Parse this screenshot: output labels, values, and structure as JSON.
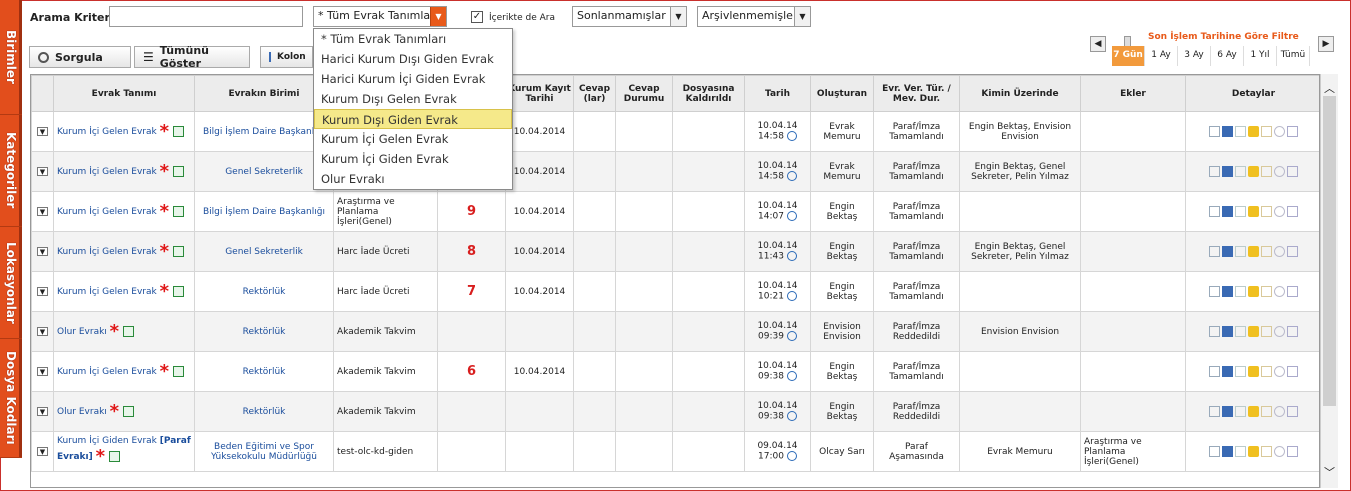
{
  "sidebar": {
    "tabs": [
      "Birimler",
      "Kategoriler",
      "Lokasyonlar",
      "Dosya Kodları"
    ]
  },
  "search": {
    "label": "Arama Kriteri",
    "value": "",
    "placeholder": ""
  },
  "type_select": {
    "selected": "* Tüm Evrak Tanımları"
  },
  "search_in": {
    "label": "İçerikte de Ara",
    "checked": true
  },
  "status_select": {
    "selected": "Sonlanmamışlar"
  },
  "archive_select": {
    "selected": "Arşivlenmemişler"
  },
  "buttons": {
    "query": "Sorgula",
    "show_all": "Tümünü Göster",
    "columns": "Kolon"
  },
  "dropdown_options": [
    "* Tüm Evrak Tanımları",
    "Harici Kurum Dışı Giden Evrak",
    "Harici Kurum İçi Giden Evrak",
    "Kurum Dışı Gelen Evrak",
    "Kurum Dışı Giden Evrak",
    "Kurum İçi Gelen Evrak",
    "Kurum İçi Giden Evrak",
    "Olur Evrakı"
  ],
  "dropdown_selected_index": 4,
  "filter": {
    "title": "Son İşlem Tarihine Göre Filtre",
    "options": [
      "7 Gün",
      "1 Ay",
      "3 Ay",
      "6 Ay",
      "1 Yıl",
      "Tümü"
    ],
    "active": 0
  },
  "headers": [
    "",
    "Evrak Tanımı",
    "Evrakın Birimi",
    "",
    "",
    "Kurum Kayıt Tarihi",
    "Cevap (lar)",
    "Cevap Durumu",
    "Dosyasına Kaldırıldı",
    "Tarih",
    "Oluşturan",
    "Evr. Ver. Tür. / Mev. Dur.",
    "Kimin Üzerinde",
    "Ekler",
    "Detaylar"
  ],
  "rows": [
    {
      "type": "Kurum İçi Gelen Evrak",
      "unit": "Bilgi İşlem Daire Başkanlığı",
      "subject": "",
      "num": "",
      "reg": "10.04.2014",
      "date": "10.04.14",
      "time": "14:58",
      "creator": "Evrak Memuru",
      "status": "Paraf/İmza Tamamlandı",
      "holder": "Engin Bektaş, Envision Envision",
      "att": ""
    },
    {
      "type": "Kurum İçi Gelen Evrak",
      "unit": "Genel Sekreterlik",
      "subject": "",
      "num": "",
      "reg": "10.04.2014",
      "date": "10.04.14",
      "time": "14:58",
      "creator": "Evrak Memuru",
      "status": "Paraf/İmza Tamamlandı",
      "holder": "Engin Bektaş, Genel Sekreter, Pelin Yılmaz",
      "att": ""
    },
    {
      "type": "Kurum İçi Gelen Evrak",
      "unit": "Bilgi İşlem Daire Başkanlığı",
      "subject": "Araştırma ve Planlama İşleri(Genel)",
      "num": "9",
      "reg": "10.04.2014",
      "date": "10.04.14",
      "time": "14:07",
      "creator": "Engin Bektaş",
      "status": "Paraf/İmza Tamamlandı",
      "holder": "",
      "att": ""
    },
    {
      "type": "Kurum İçi Gelen Evrak",
      "unit": "Genel Sekreterlik",
      "subject": "Harc İade Ücreti",
      "num": "8",
      "reg": "10.04.2014",
      "date": "10.04.14",
      "time": "11:43",
      "creator": "Engin Bektaş",
      "status": "Paraf/İmza Tamamlandı",
      "holder": "Engin Bektaş, Genel Sekreter, Pelin Yılmaz",
      "att": ""
    },
    {
      "type": "Kurum İçi Gelen Evrak",
      "unit": "Rektörlük",
      "subject": "Harc İade Ücreti",
      "num": "7",
      "reg": "10.04.2014",
      "date": "10.04.14",
      "time": "10:21",
      "creator": "Engin Bektaş",
      "status": "Paraf/İmza Tamamlandı",
      "holder": "",
      "att": ""
    },
    {
      "type": "Olur Evrakı",
      "unit": "Rektörlük",
      "subject": "Akademik Takvim",
      "num": "",
      "reg": "",
      "date": "10.04.14",
      "time": "09:39",
      "creator": "Envision Envision",
      "status": "Paraf/İmza Reddedildi",
      "holder": "Envision Envision",
      "att": ""
    },
    {
      "type": "Kurum İçi Gelen Evrak",
      "unit": "Rektörlük",
      "subject": "Akademik Takvim",
      "num": "6",
      "reg": "10.04.2014",
      "date": "10.04.14",
      "time": "09:38",
      "creator": "Engin Bektaş",
      "status": "Paraf/İmza Tamamlandı",
      "holder": "",
      "att": ""
    },
    {
      "type": "Olur Evrakı",
      "unit": "Rektörlük",
      "subject": "Akademik Takvim",
      "num": "",
      "reg": "",
      "date": "10.04.14",
      "time": "09:38",
      "creator": "Engin Bektaş",
      "status": "Paraf/İmza Reddedildi",
      "holder": "",
      "att": ""
    },
    {
      "type": "Kurum İçi Giden Evrak",
      "type_extra": "[Paraf Evrakı]",
      "unit": "Beden Eğitimi ve Spor Yüksekokulu Müdürlüğü",
      "subject": "test-olc-kd-giden",
      "num": "",
      "reg": "",
      "date": "09.04.14",
      "time": "17:00",
      "creator": "Olcay Sarı",
      "status": "Paraf Aşamasında",
      "holder": "Evrak Memuru",
      "att": "Araştırma ve Planlama İşleri(Genel)"
    }
  ],
  "colors": {
    "sidebar": "#e24e1c",
    "accent": "#e85a1a",
    "link": "#1a4d9c",
    "number": "#d81e1e",
    "highlight": "#f5e98a"
  }
}
